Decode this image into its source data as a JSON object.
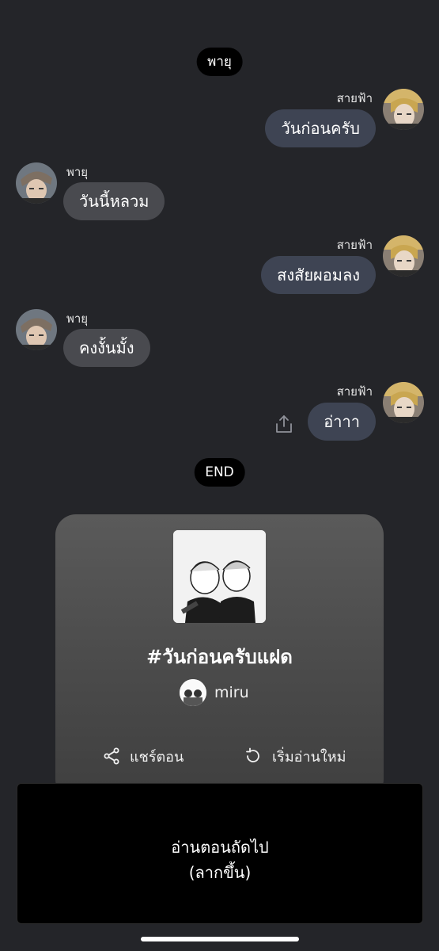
{
  "chat": {
    "header_pill": "พายุ",
    "end_pill": "END",
    "messages": [
      {
        "side": "right",
        "sender": "สายฟ้า",
        "text": "วันก่อนครับ"
      },
      {
        "side": "left",
        "sender": "พายุ",
        "text": "วันนี้หลวม"
      },
      {
        "side": "right",
        "sender": "สายฟ้า",
        "text": "สงสัยผอมลง"
      },
      {
        "side": "left",
        "sender": "พายุ",
        "text": "คงงั้นมั้ง"
      },
      {
        "side": "right",
        "sender": "สายฟ้า",
        "text": "อ่าาา"
      }
    ],
    "share_icon": "share-upload-icon"
  },
  "card": {
    "title": "#วันก่อนครับแฝด",
    "author": "miru",
    "share_label": "แชร์ตอน",
    "restart_label": "เริ่มอ่านใหม่"
  },
  "next": {
    "line1": "อ่านตอนถัดไป",
    "line2": "(ลากขึ้น)"
  },
  "colors": {
    "background": "#242529",
    "bubble_right": "#3e4453",
    "bubble_left": "#494a4f",
    "pill": "#000000"
  }
}
